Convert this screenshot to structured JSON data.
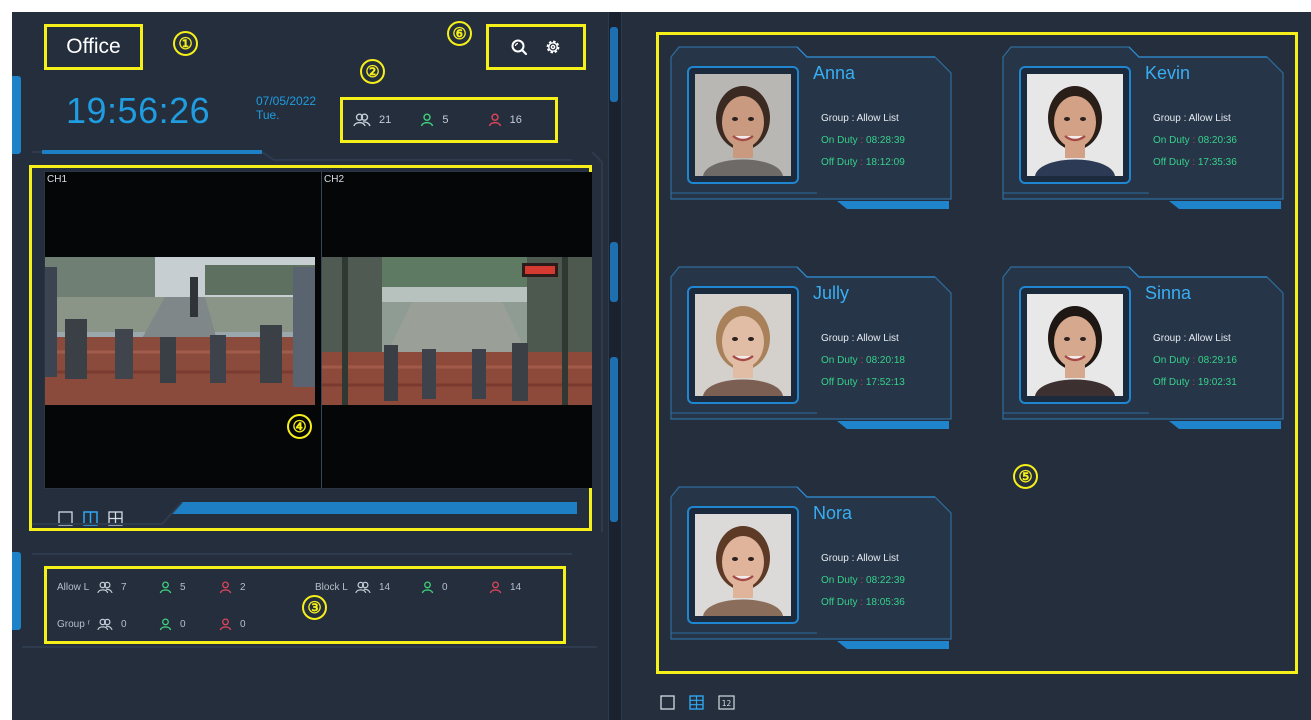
{
  "header": {
    "site_name": "Office",
    "time": "19:56:26",
    "date": "07/05/2022",
    "weekday": "Tue."
  },
  "counts": {
    "total": "21",
    "present": "5",
    "absent": "16"
  },
  "video": {
    "ch1_label": "CH1",
    "ch2_label": "CH2"
  },
  "stats": {
    "allow_label": "Allow L",
    "allow_total": "7",
    "allow_present": "5",
    "allow_absent": "2",
    "block_label": "Block L",
    "block_total": "14",
    "block_present": "0",
    "block_absent": "14",
    "group_label": "Group ʳ",
    "group_total": "0",
    "group_present": "0",
    "group_absent": "0"
  },
  "markers": [
    "①",
    "②",
    "③",
    "④",
    "⑤",
    "⑥"
  ],
  "labels": {
    "group_prefix": "Group  : ",
    "on_duty": "On Duty",
    "off_duty": "Off Duty",
    "sep": " : "
  },
  "people": [
    {
      "name": "Anna",
      "group": "Allow List",
      "on_duty": "08:28:39",
      "off_duty": "18:12:09",
      "shirt": "#6e6a68",
      "hair": "#3a2a22",
      "skin": "#c99a7f",
      "bg": "#b9b7b4"
    },
    {
      "name": "Kevin",
      "group": "Allow List",
      "on_duty": "08:20:36",
      "off_duty": "17:35:36",
      "shirt": "#2c3a55",
      "hair": "#2a1e18",
      "skin": "#d3a185",
      "bg": "#e7e7e7"
    },
    {
      "name": "Jully",
      "group": "Allow List",
      "on_duty": "08:20:18",
      "off_duty": "17:52:13",
      "shirt": "#7a5f52",
      "hair": "#a8805a",
      "skin": "#e1bda5",
      "bg": "#d4d0cc"
    },
    {
      "name": "Sinna",
      "group": "Allow List",
      "on_duty": "08:29:16",
      "off_duty": "19:02:31",
      "shirt": "#3c3030",
      "hair": "#1e1714",
      "skin": "#d6a88e",
      "bg": "#e8e8e8"
    },
    {
      "name": "Nora",
      "group": "Allow List",
      "on_duty": "08:22:39",
      "off_duty": "18:05:36",
      "shirt": "#8a6d5b",
      "hair": "#5c3a26",
      "skin": "#e0b49a",
      "bg": "#dcdad8"
    }
  ],
  "colors": {
    "accent": "#1f9de0",
    "highlight": "#f5ef1a",
    "on_duty_text": "#36d18a",
    "background": "#242e3d"
  }
}
